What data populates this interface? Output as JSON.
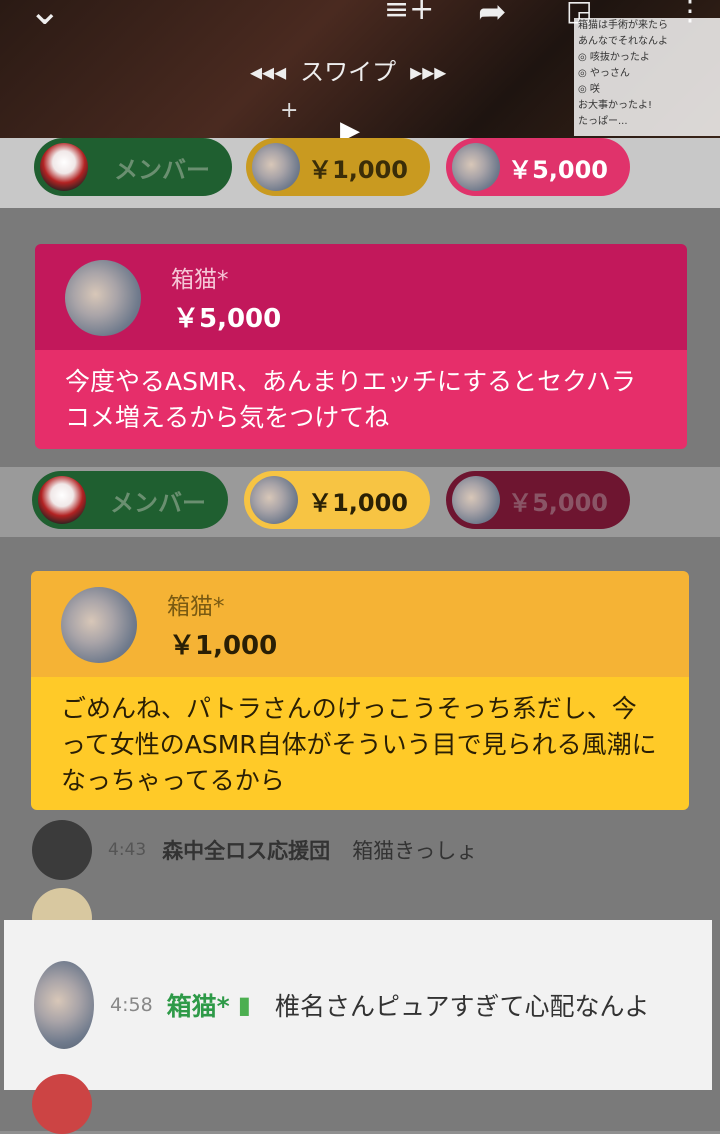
{
  "video": {
    "swipe_label": "スワイプ",
    "arrows_left": "◂◂◂",
    "arrows_right": "▸▸▸",
    "plus": "+",
    "play": "▶"
  },
  "mini_chat": {
    "lines": [
      "箱猫は手術が来たら",
      "あんなでそれなんよ",
      "◎ 咳抜かったよ",
      "◎ やっさん",
      "◎ 咲",
      "お大事かったよ!",
      "たっぱー..."
    ]
  },
  "pill_bar_top": {
    "member_label": "メンバー",
    "tier1_label": "￥1,000",
    "tier2_label": "￥5,000"
  },
  "superchat_red": {
    "name": "箱猫*",
    "amount": "￥5,000",
    "message": "今度やるASMR、あんまりエッチにするとセクハラコメ増えるから気をつけてね",
    "header_color": "#c2185b",
    "body_color": "#e91e63"
  },
  "pill_bar_bottom": {
    "member_label": "メンバー",
    "tier1_label": "￥1,000",
    "tier2_label": "￥5,000"
  },
  "superchat_yellow": {
    "name": "箱猫*",
    "amount": "￥1,000",
    "message": "ごめんね、パトラさんのけっこうそっち系だし、今って女性のASMR自体がそういう目で見られる風潮になっちゃってるから",
    "header_color": "#f5b335",
    "body_color": "#ffca28"
  },
  "chat": [
    {
      "time": "4:43",
      "author": "森中全ロス応援団",
      "text": "箱猫きっしょ"
    }
  ],
  "highlight_message": {
    "time": "4:58",
    "author": "箱猫*",
    "text": "椎名さんピュアすぎて心配なんよ"
  }
}
